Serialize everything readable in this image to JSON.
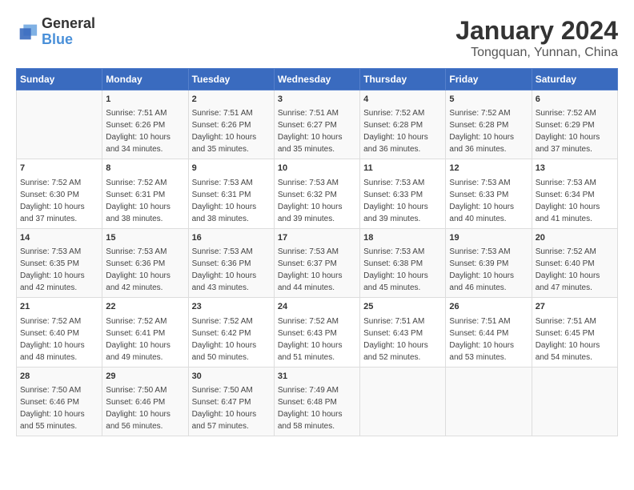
{
  "logo": {
    "text1": "General",
    "text2": "Blue"
  },
  "title": "January 2024",
  "subtitle": "Tongquan, Yunnan, China",
  "days_header": [
    "Sunday",
    "Monday",
    "Tuesday",
    "Wednesday",
    "Thursday",
    "Friday",
    "Saturday"
  ],
  "weeks": [
    [
      {
        "num": "",
        "detail": ""
      },
      {
        "num": "1",
        "detail": "Sunrise: 7:51 AM\nSunset: 6:26 PM\nDaylight: 10 hours\nand 34 minutes."
      },
      {
        "num": "2",
        "detail": "Sunrise: 7:51 AM\nSunset: 6:26 PM\nDaylight: 10 hours\nand 35 minutes."
      },
      {
        "num": "3",
        "detail": "Sunrise: 7:51 AM\nSunset: 6:27 PM\nDaylight: 10 hours\nand 35 minutes."
      },
      {
        "num": "4",
        "detail": "Sunrise: 7:52 AM\nSunset: 6:28 PM\nDaylight: 10 hours\nand 36 minutes."
      },
      {
        "num": "5",
        "detail": "Sunrise: 7:52 AM\nSunset: 6:28 PM\nDaylight: 10 hours\nand 36 minutes."
      },
      {
        "num": "6",
        "detail": "Sunrise: 7:52 AM\nSunset: 6:29 PM\nDaylight: 10 hours\nand 37 minutes."
      }
    ],
    [
      {
        "num": "7",
        "detail": "Sunrise: 7:52 AM\nSunset: 6:30 PM\nDaylight: 10 hours\nand 37 minutes."
      },
      {
        "num": "8",
        "detail": "Sunrise: 7:52 AM\nSunset: 6:31 PM\nDaylight: 10 hours\nand 38 minutes."
      },
      {
        "num": "9",
        "detail": "Sunrise: 7:53 AM\nSunset: 6:31 PM\nDaylight: 10 hours\nand 38 minutes."
      },
      {
        "num": "10",
        "detail": "Sunrise: 7:53 AM\nSunset: 6:32 PM\nDaylight: 10 hours\nand 39 minutes."
      },
      {
        "num": "11",
        "detail": "Sunrise: 7:53 AM\nSunset: 6:33 PM\nDaylight: 10 hours\nand 39 minutes."
      },
      {
        "num": "12",
        "detail": "Sunrise: 7:53 AM\nSunset: 6:33 PM\nDaylight: 10 hours\nand 40 minutes."
      },
      {
        "num": "13",
        "detail": "Sunrise: 7:53 AM\nSunset: 6:34 PM\nDaylight: 10 hours\nand 41 minutes."
      }
    ],
    [
      {
        "num": "14",
        "detail": "Sunrise: 7:53 AM\nSunset: 6:35 PM\nDaylight: 10 hours\nand 42 minutes."
      },
      {
        "num": "15",
        "detail": "Sunrise: 7:53 AM\nSunset: 6:36 PM\nDaylight: 10 hours\nand 42 minutes."
      },
      {
        "num": "16",
        "detail": "Sunrise: 7:53 AM\nSunset: 6:36 PM\nDaylight: 10 hours\nand 43 minutes."
      },
      {
        "num": "17",
        "detail": "Sunrise: 7:53 AM\nSunset: 6:37 PM\nDaylight: 10 hours\nand 44 minutes."
      },
      {
        "num": "18",
        "detail": "Sunrise: 7:53 AM\nSunset: 6:38 PM\nDaylight: 10 hours\nand 45 minutes."
      },
      {
        "num": "19",
        "detail": "Sunrise: 7:53 AM\nSunset: 6:39 PM\nDaylight: 10 hours\nand 46 minutes."
      },
      {
        "num": "20",
        "detail": "Sunrise: 7:52 AM\nSunset: 6:40 PM\nDaylight: 10 hours\nand 47 minutes."
      }
    ],
    [
      {
        "num": "21",
        "detail": "Sunrise: 7:52 AM\nSunset: 6:40 PM\nDaylight: 10 hours\nand 48 minutes."
      },
      {
        "num": "22",
        "detail": "Sunrise: 7:52 AM\nSunset: 6:41 PM\nDaylight: 10 hours\nand 49 minutes."
      },
      {
        "num": "23",
        "detail": "Sunrise: 7:52 AM\nSunset: 6:42 PM\nDaylight: 10 hours\nand 50 minutes."
      },
      {
        "num": "24",
        "detail": "Sunrise: 7:52 AM\nSunset: 6:43 PM\nDaylight: 10 hours\nand 51 minutes."
      },
      {
        "num": "25",
        "detail": "Sunrise: 7:51 AM\nSunset: 6:43 PM\nDaylight: 10 hours\nand 52 minutes."
      },
      {
        "num": "26",
        "detail": "Sunrise: 7:51 AM\nSunset: 6:44 PM\nDaylight: 10 hours\nand 53 minutes."
      },
      {
        "num": "27",
        "detail": "Sunrise: 7:51 AM\nSunset: 6:45 PM\nDaylight: 10 hours\nand 54 minutes."
      }
    ],
    [
      {
        "num": "28",
        "detail": "Sunrise: 7:50 AM\nSunset: 6:46 PM\nDaylight: 10 hours\nand 55 minutes."
      },
      {
        "num": "29",
        "detail": "Sunrise: 7:50 AM\nSunset: 6:46 PM\nDaylight: 10 hours\nand 56 minutes."
      },
      {
        "num": "30",
        "detail": "Sunrise: 7:50 AM\nSunset: 6:47 PM\nDaylight: 10 hours\nand 57 minutes."
      },
      {
        "num": "31",
        "detail": "Sunrise: 7:49 AM\nSunset: 6:48 PM\nDaylight: 10 hours\nand 58 minutes."
      },
      {
        "num": "",
        "detail": ""
      },
      {
        "num": "",
        "detail": ""
      },
      {
        "num": "",
        "detail": ""
      }
    ]
  ]
}
